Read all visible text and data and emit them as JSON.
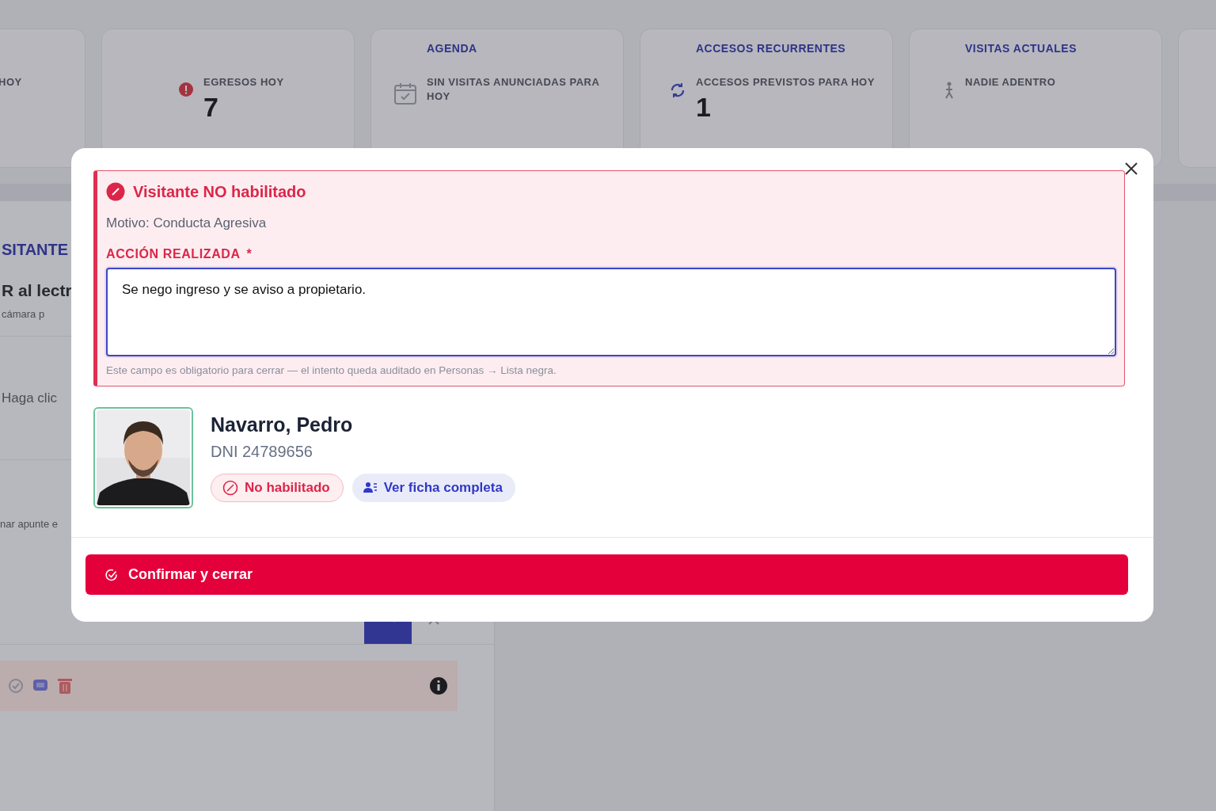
{
  "background": {
    "stat_cards": [
      {
        "kind": "plain",
        "label": "HOY"
      },
      {
        "kind": "egress",
        "label": "EGRESOS HOY",
        "value": "7"
      },
      {
        "kind": "calendar",
        "title": "AGENDA",
        "label": "SIN VISITAS ANUNCIADAS PARA HOY"
      },
      {
        "kind": "recurring",
        "title": "ACCESOS RECURRENTES",
        "label": "ACCESOS PREVISTOS PARA HOY",
        "value": "1"
      },
      {
        "kind": "person",
        "title": "VISITAS ACTUALES",
        "label": "NADIE ADENTRO"
      },
      {
        "kind": "empty"
      }
    ],
    "left_panel": {
      "section_title": "SITANTE",
      "heading": "R al lectr",
      "subtext": "cámara p",
      "hint": "Haga clic",
      "note": "nar apunte e"
    }
  },
  "modal": {
    "alert": {
      "title": "Visitante NO habilitado",
      "reason": "Motivo: Conducta Agresiva",
      "field_label": "ACCIÓN REALIZADA",
      "required_mark": "*",
      "value": "Se nego ingreso y se aviso a propietario.",
      "hint": "Este campo es obligatorio para cerrar — el intento queda auditado en Personas → Lista negra."
    },
    "person": {
      "name": "Navarro, Pedro",
      "document": "DNI 24789656",
      "status": "No habilitado",
      "profile_link": "Ver ficha completa"
    },
    "confirm_button": "Confirmar y cerrar"
  }
}
